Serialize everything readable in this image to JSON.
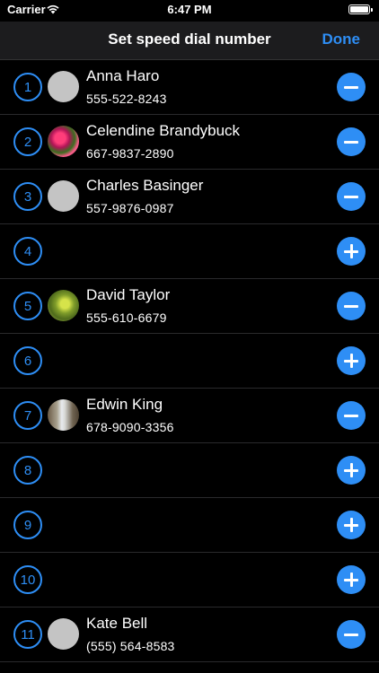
{
  "status": {
    "carrier": "Carrier",
    "time": "6:47 PM",
    "battery_level": 1.0
  },
  "nav": {
    "title": "Set speed dial number",
    "done_label": "Done"
  },
  "rows": [
    {
      "number": "1",
      "name": "Anna Haro",
      "phone": "555-522-8243",
      "avatar": "gray",
      "action": "remove"
    },
    {
      "number": "2",
      "name": "Celendine Brandybuck",
      "phone": "667-9837-2890",
      "avatar": "flowers",
      "action": "remove"
    },
    {
      "number": "3",
      "name": "Charles Basinger",
      "phone": "557-9876-0987",
      "avatar": "gray",
      "action": "remove"
    },
    {
      "number": "4",
      "name": "",
      "phone": "",
      "avatar": "",
      "action": "add"
    },
    {
      "number": "5",
      "name": "David Taylor",
      "phone": "555-610-6679",
      "avatar": "leaves",
      "action": "remove"
    },
    {
      "number": "6",
      "name": "",
      "phone": "",
      "avatar": "",
      "action": "add"
    },
    {
      "number": "7",
      "name": "Edwin King",
      "phone": "678-9090-3356",
      "avatar": "waterfall",
      "action": "remove"
    },
    {
      "number": "8",
      "name": "",
      "phone": "",
      "avatar": "",
      "action": "add"
    },
    {
      "number": "9",
      "name": "",
      "phone": "",
      "avatar": "",
      "action": "add"
    },
    {
      "number": "10",
      "name": "",
      "phone": "",
      "avatar": "",
      "action": "add"
    },
    {
      "number": "11",
      "name": "Kate Bell",
      "phone": "(555) 564-8583",
      "avatar": "gray",
      "action": "remove"
    }
  ],
  "colors": {
    "accent": "#2e8ef5",
    "background": "#000000",
    "navbar": "#1c1c1e"
  }
}
